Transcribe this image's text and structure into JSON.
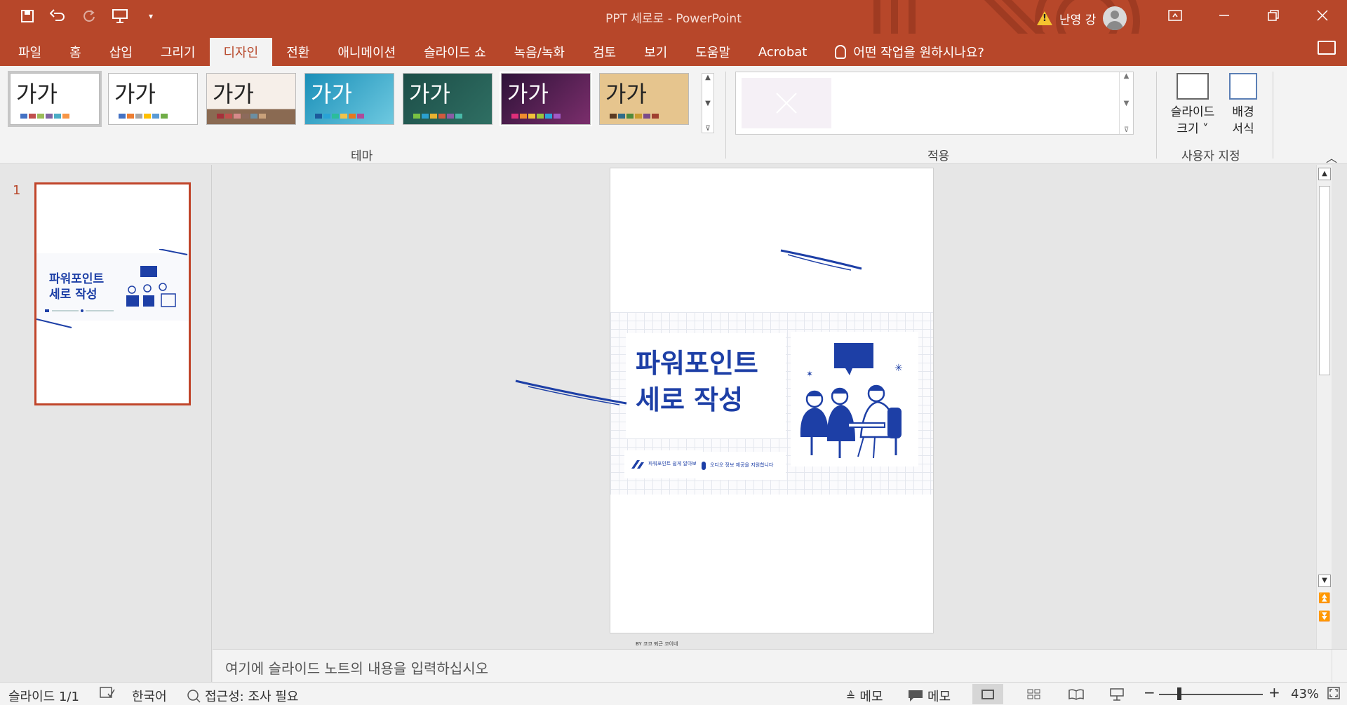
{
  "app": {
    "window_title": "PPT 세로로  -  PowerPoint",
    "user_name": "난영 강"
  },
  "colors": {
    "accent": "#b7472a",
    "slide_blue": "#1d3fa6"
  },
  "quick_access": [
    {
      "name": "save-icon",
      "glyph": "🖫"
    },
    {
      "name": "undo-icon",
      "glyph": "↶"
    },
    {
      "name": "redo-icon",
      "glyph": "↻"
    },
    {
      "name": "present-from-start-icon",
      "glyph": "⎚"
    },
    {
      "name": "customize-qat-icon",
      "glyph": "▾"
    }
  ],
  "ribbon_tabs": [
    "파일",
    "홈",
    "삽입",
    "그리기",
    "디자인",
    "전환",
    "애니메이션",
    "슬라이드 쇼",
    "녹음/녹화",
    "검토",
    "보기",
    "도움말",
    "Acrobat"
  ],
  "active_tab": "디자인",
  "tell_me": "어떤 작업을 원하시나요?",
  "themes": {
    "sample_text": "가가",
    "group_label": "테마"
  },
  "variants": {
    "group_label": "적용"
  },
  "customize": {
    "slide_size_line1": "슬라이드",
    "slide_size_line2": "크기 ˅",
    "format_bg_line1": "배경",
    "format_bg_line2": "서식",
    "group_label": "사용자 지정"
  },
  "thumbnail": {
    "number": "1",
    "title_line1": "파워포인트",
    "title_line2": "세로 작성"
  },
  "slide": {
    "title_line1": "파워포인트",
    "title_line2": "세로 작성",
    "logo_text": "파워포인트 쉽게 알아보기",
    "info_text": "오디오 정보 제공을 지원합니다",
    "footer_text": "BY 코코 퇴근 코이네"
  },
  "notes": {
    "placeholder": "여기에 슬라이드 노트의 내용을 입력하십시오"
  },
  "statusbar": {
    "slide_count": "슬라이드 1/1",
    "language": "한국어",
    "accessibility": "접근성: 조사 필요",
    "notes_label": "메모",
    "comments_label": "메모",
    "zoom_minus": "−",
    "zoom_plus": "+",
    "zoom_percent": "43%"
  }
}
